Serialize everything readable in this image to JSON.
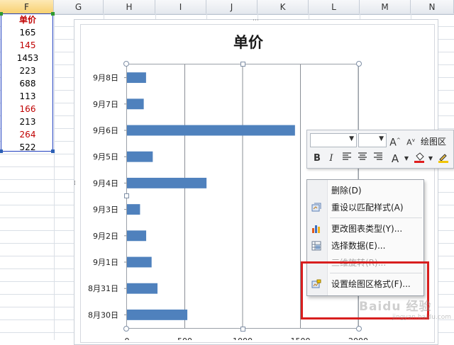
{
  "columns": [
    "F",
    "G",
    "H",
    "I",
    "J",
    "K",
    "L",
    "M",
    "N"
  ],
  "f_column": {
    "header": "单价",
    "values": [
      {
        "text": "165",
        "color": "#1a1a1a"
      },
      {
        "text": "145",
        "color": "#c00000"
      },
      {
        "text": "1453",
        "color": "#1a1a1a"
      },
      {
        "text": "223",
        "color": "#1a1a1a"
      },
      {
        "text": "688",
        "color": "#1a1a1a"
      },
      {
        "text": "113",
        "color": "#1a1a1a"
      },
      {
        "text": "166",
        "color": "#c00000"
      },
      {
        "text": "213",
        "color": "#1a1a1a"
      },
      {
        "text": "264",
        "color": "#c00000"
      },
      {
        "text": "522",
        "color": "#1a1a1a"
      }
    ]
  },
  "chart_data": {
    "type": "bar",
    "orientation": "horizontal",
    "title": "单价",
    "categories": [
      "9月8日",
      "9月7日",
      "9月6日",
      "9月5日",
      "9月4日",
      "9月3日",
      "9月2日",
      "9月1日",
      "8月31日",
      "8月30日"
    ],
    "values": [
      165,
      145,
      1453,
      223,
      688,
      113,
      166,
      213,
      264,
      522
    ],
    "x_ticks": [
      "0",
      "500",
      "1000",
      "1500",
      "2000"
    ],
    "xlim": [
      0,
      2000
    ],
    "xgrid": true,
    "bar_color": "#4f81bd",
    "legend": "none"
  },
  "mini_toolbar": {
    "font_name": "",
    "font_size": "",
    "grow_font": "A",
    "shrink_font": "A",
    "element_label": "绘图区",
    "bold": "B",
    "italic": "I",
    "font_color_glyph": "A"
  },
  "context_menu": {
    "items": [
      {
        "label": "删除(D)",
        "disabled": false
      },
      {
        "label": "重设以匹配样式(A)",
        "disabled": false
      },
      {
        "label": "更改图表类型(Y)...",
        "disabled": false
      },
      {
        "label": "选择数据(E)...",
        "disabled": false
      },
      {
        "label": "三维旋转(R)...",
        "disabled": true
      },
      {
        "label": "设置绘图区格式(F)...",
        "disabled": false
      }
    ]
  },
  "watermark": {
    "text": "Baidu 经验",
    "sub": "jingyan.baidu.com"
  },
  "colors": {
    "highlight": "#d81e1e",
    "selection": "#1f3fbf",
    "header_text": "#c00000"
  }
}
